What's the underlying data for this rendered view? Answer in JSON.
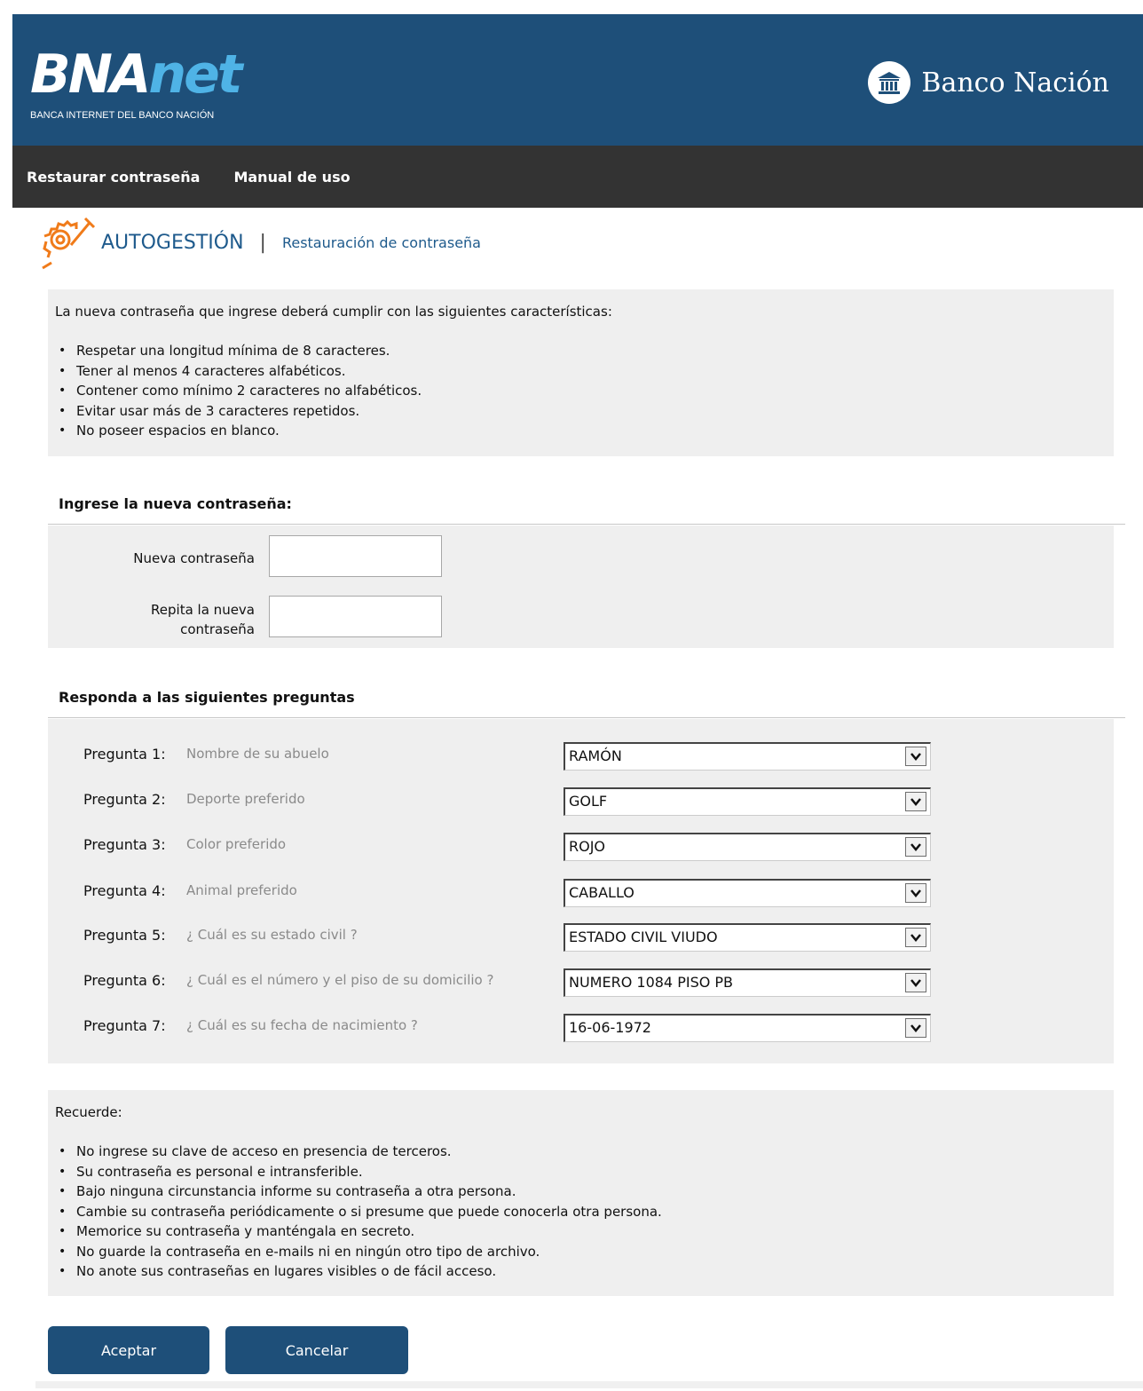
{
  "header": {
    "logo_main": "BNA",
    "logo_net": "net",
    "logo_sub": "BANCA INTERNET DEL BANCO NACIÓN",
    "brand_name": "Banco Nación"
  },
  "nav": {
    "items": [
      {
        "label": "Restaurar contraseña"
      },
      {
        "label": "Manual de uso"
      }
    ]
  },
  "title": {
    "main": "AUTOGESTIÓN",
    "separator": "|",
    "sub": "Restauración de contraseña"
  },
  "rules": {
    "intro": "La nueva contraseña que ingrese deberá cumplir con las siguientes características:",
    "items": [
      "Respetar una longitud mínima de 8 caracteres.",
      "Tener al menos 4 caracteres alfabéticos.",
      "Contener como mínimo 2 caracteres no alfabéticos.",
      "Evitar usar más de 3 caracteres repetidos.",
      "No poseer espacios en blanco."
    ]
  },
  "password_section": {
    "title": "Ingrese la nueva contraseña:",
    "new_label": "Nueva contraseña",
    "repeat_label_line1": "Repita la nueva",
    "repeat_label_line2": "contraseña",
    "new_value": "",
    "repeat_value": ""
  },
  "questions_section": {
    "title": "Responda a las siguientes preguntas",
    "questions": [
      {
        "num": "Pregunta 1:",
        "text": "Nombre de su abuelo",
        "value": "RAMÓN"
      },
      {
        "num": "Pregunta 2:",
        "text": "Deporte preferido",
        "value": "GOLF"
      },
      {
        "num": "Pregunta 3:",
        "text": "Color preferido",
        "value": "ROJO"
      },
      {
        "num": "Pregunta 4:",
        "text": "Animal preferido",
        "value": "CABALLO"
      },
      {
        "num": "Pregunta 5:",
        "text": "¿ Cuál es su estado civil ?",
        "value": "ESTADO CIVIL VIUDO"
      },
      {
        "num": "Pregunta 6:",
        "text": "¿ Cuál es el número y el piso de su domicilio ?",
        "value": "NUMERO 1084 PISO PB"
      },
      {
        "num": "Pregunta 7:",
        "text": "¿ Cuál es su fecha de nacimiento ?",
        "value": "16-06-1972"
      }
    ]
  },
  "remember": {
    "title": "Recuerde:",
    "items": [
      "No ingrese su clave de acceso en presencia de terceros.",
      "Su contraseña es personal e intransferible.",
      "Bajo ninguna circunstancia informe su contraseña a otra persona.",
      "Cambie su contraseña periódicamente o si presume que puede conocerla otra persona.",
      "Memorice su contraseña y manténgala en secreto.",
      "No guarde la contraseña en e-mails ni en ningún otro tipo de archivo.",
      "No anote sus contraseñas en lugares visibles o de fácil acceso."
    ]
  },
  "buttons": {
    "accept": "Aceptar",
    "cancel": "Cancelar"
  },
  "colors": {
    "header_bg": "#1e4f79",
    "nav_bg": "#333333",
    "panel_bg": "#efefef",
    "accent_text": "#1e5a8c",
    "logo_net": "#4fb3e6",
    "gear_icon": "#f07b1a"
  },
  "icons": {
    "bank_seal": "bank-seal-icon",
    "gear": "gear-wrench-icon",
    "dropdown": "chevron-down-icon"
  }
}
